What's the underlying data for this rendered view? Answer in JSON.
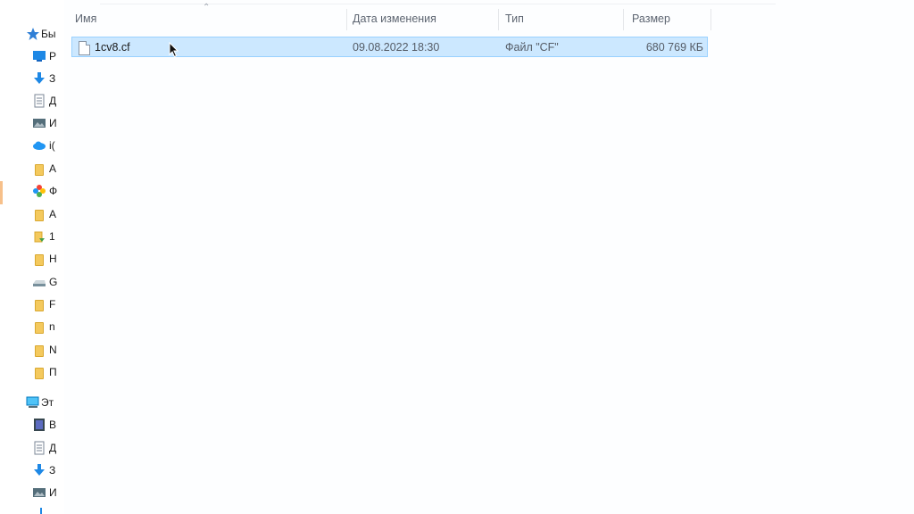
{
  "sidebar": {
    "quick_access": {
      "label": "Бы",
      "icon": "star-icon"
    },
    "items": [
      {
        "label": "Р",
        "icon": "desktop-icon"
      },
      {
        "label": "З",
        "icon": "download-icon"
      },
      {
        "label": "Д",
        "icon": "documents-icon"
      },
      {
        "label": "И",
        "icon": "pictures-icon"
      },
      {
        "label": "i(",
        "icon": "icloud-icon"
      },
      {
        "label": "А",
        "icon": "folder-icon"
      },
      {
        "label": "Ф",
        "icon": "photos-icon"
      },
      {
        "label": "А",
        "icon": "folder-icon"
      },
      {
        "label": "1",
        "icon": "folder-download-icon"
      },
      {
        "label": "Н",
        "icon": "folder-icon"
      },
      {
        "label": "G",
        "icon": "drive-icon"
      },
      {
        "label": "F",
        "icon": "folder-icon"
      },
      {
        "label": "n",
        "icon": "folder-icon"
      },
      {
        "label": "N",
        "icon": "folder-icon"
      },
      {
        "label": "П",
        "icon": "folder-icon"
      }
    ],
    "this_pc": {
      "label": "Эт",
      "icon": "computer-icon"
    },
    "pc_items": [
      {
        "label": "В",
        "icon": "video-icon"
      },
      {
        "label": "Д",
        "icon": "documents-icon"
      },
      {
        "label": "З",
        "icon": "download-icon"
      },
      {
        "label": "И",
        "icon": "pictures-icon"
      }
    ]
  },
  "columns": {
    "name": "Имя",
    "date": "Дата изменения",
    "type": "Тип",
    "size": "Размер"
  },
  "files": [
    {
      "name": "1cv8.cf",
      "date": "09.08.2022 18:30",
      "type": "Файл \"CF\"",
      "size": "680 769 КБ",
      "selected": true
    }
  ]
}
